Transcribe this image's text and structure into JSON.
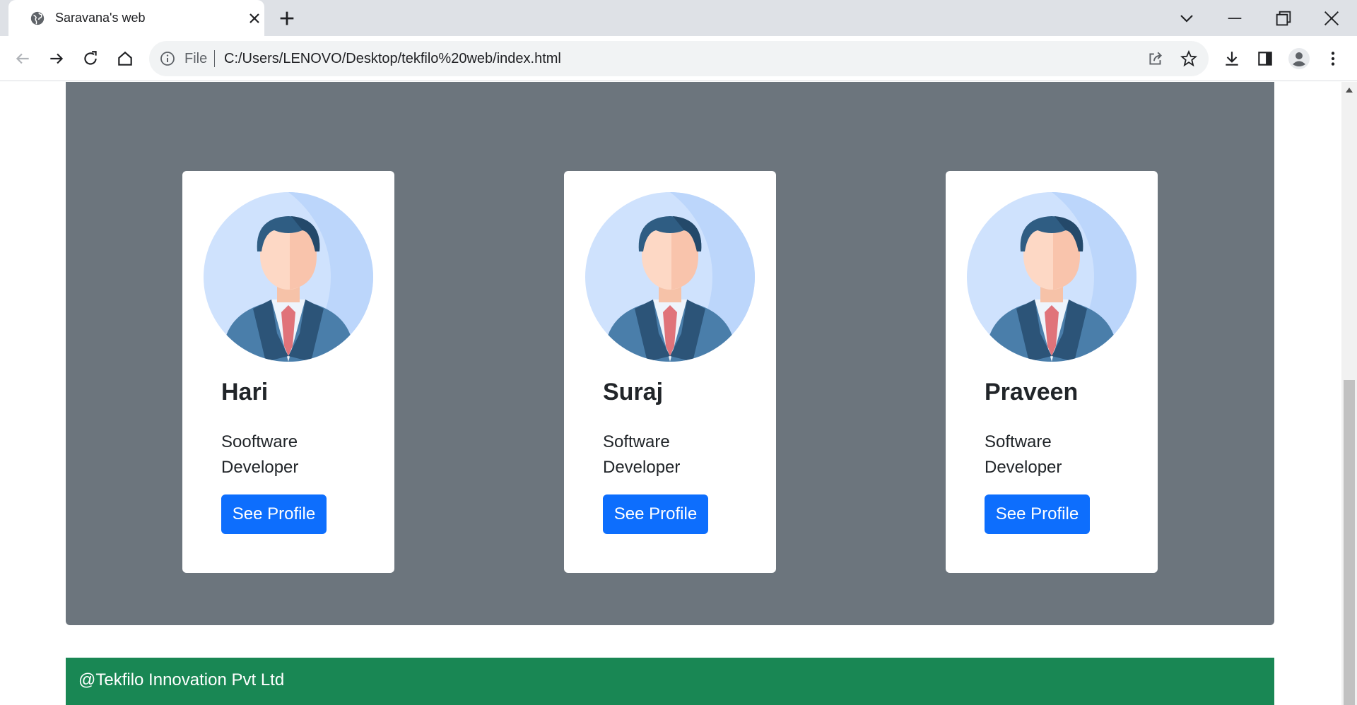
{
  "browser": {
    "tab_title": "Saravana's web",
    "address": {
      "scheme_label": "File",
      "url": "C:/Users/LENOVO/Desktop/tekfilo%20web/index.html"
    },
    "icons": {
      "tab": "globe-icon",
      "back": "back-arrow-icon",
      "forward": "forward-arrow-icon",
      "reload": "reload-icon",
      "home": "home-icon",
      "share": "share-icon",
      "bookmark": "star-icon",
      "download": "download-icon",
      "side_panel": "side-panel-icon",
      "profile": "profile-icon",
      "menu": "kebab-menu-icon"
    }
  },
  "team": {
    "background": "#6c757d",
    "cards": [
      {
        "name": "Hari",
        "role": "Sooftware Developer",
        "button": "See Profile"
      },
      {
        "name": "Suraj",
        "role": "Software Developer",
        "button": "See Profile"
      },
      {
        "name": "Praveen",
        "role": "Software Developer",
        "button": "See Profile"
      }
    ]
  },
  "footer": {
    "text": "@Tekfilo Innovation Pvt Ltd",
    "color": "#198754"
  },
  "colors": {
    "primary_button": "#0d6efd"
  }
}
